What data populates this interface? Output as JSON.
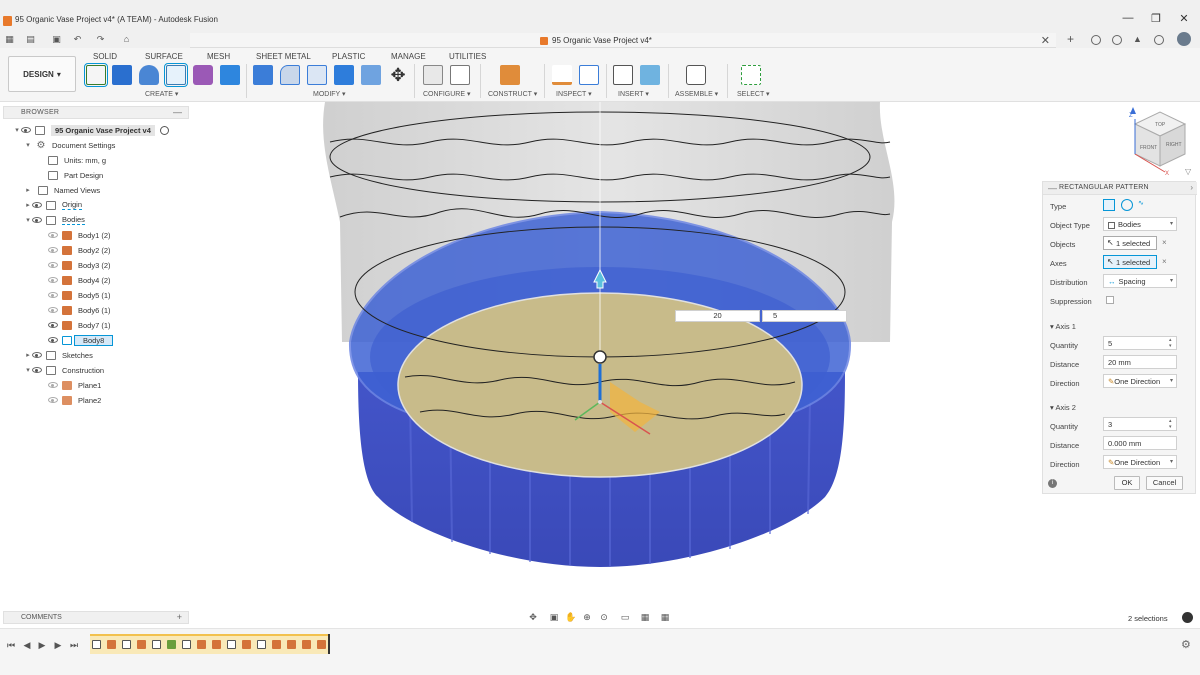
{
  "window": {
    "title": "95 Organic Vase Project v4* (A TEAM) - Autodesk Fusion",
    "minimize": "—",
    "maximize": "❐",
    "close": "✕"
  },
  "document_tab": {
    "title": "95 Organic Vase Project v4*",
    "close": "✕"
  },
  "workspace": {
    "label": "DESIGN",
    "caret": "▾"
  },
  "ribbon": {
    "tabs": [
      "SOLID",
      "SURFACE",
      "MESH",
      "SHEET METAL",
      "PLASTIC",
      "MANAGE",
      "UTILITIES"
    ],
    "active_tab": "SOLID",
    "groups": [
      "CREATE ▾",
      "MODIFY ▾",
      "CONFIGURE ▾",
      "CONSTRUCT ▾",
      "INSPECT ▾",
      "INSERT ▾",
      "ASSEMBLE ▾",
      "SELECT ▾"
    ]
  },
  "browser": {
    "header": "BROWSER",
    "collapse": "—",
    "root": "95 Organic Vase Project v4",
    "items": [
      {
        "label": "Document Settings"
      },
      {
        "label": "Units: mm, g"
      },
      {
        "label": "Part Design"
      },
      {
        "label": "Named Views"
      },
      {
        "label": "Origin"
      },
      {
        "label": "Bodies"
      },
      {
        "label": "Body1 (2)"
      },
      {
        "label": "Body2 (2)"
      },
      {
        "label": "Body3 (2)"
      },
      {
        "label": "Body4 (2)"
      },
      {
        "label": "Body5 (1)"
      },
      {
        "label": "Body6 (1)"
      },
      {
        "label": "Body7 (1)"
      },
      {
        "label": "Body8"
      },
      {
        "label": "Sketches"
      },
      {
        "label": "Construction"
      },
      {
        "label": "Plane1"
      },
      {
        "label": "Plane2"
      }
    ]
  },
  "viewport_inputs": {
    "distance_value": "20",
    "quantity_value": "5"
  },
  "viewcube": {
    "top": "TOP",
    "front": "FRONT",
    "right": "RIGHT",
    "axis_x": "X",
    "axis_z": "Z"
  },
  "properties": {
    "title": "RECTANGULAR PATTERN",
    "type_label": "Type",
    "object_type_label": "Object Type",
    "object_type_value": "Bodies",
    "objects_label": "Objects",
    "objects_value": "1 selected",
    "axes_label": "Axes",
    "axes_value": "1 selected",
    "distribution_label": "Distribution",
    "distribution_value": "Spacing",
    "suppression_label": "Suppression",
    "axis1_header": "Axis 1",
    "axis1_quantity_label": "Quantity",
    "axis1_quantity": "5",
    "axis1_distance_label": "Distance",
    "axis1_distance": "20 mm",
    "axis1_direction_label": "Direction",
    "axis1_direction": "One Direction",
    "axis2_header": "Axis 2",
    "axis2_quantity_label": "Quantity",
    "axis2_quantity": "3",
    "axis2_distance_label": "Distance",
    "axis2_distance": "0.000 mm",
    "axis2_direction_label": "Direction",
    "axis2_direction": "One Direction",
    "ok": "OK",
    "cancel": "Cancel"
  },
  "comments": {
    "label": "COMMENTS",
    "add": "+"
  },
  "status": {
    "selections": "2 selections"
  },
  "colors": {
    "accent": "#0696d7",
    "body_blue": "#3f5fd0",
    "body_dark_blue": "#3a4bc0",
    "sketch_profile": "#c8bb8a",
    "timeline_track": "#f9e9b8"
  }
}
